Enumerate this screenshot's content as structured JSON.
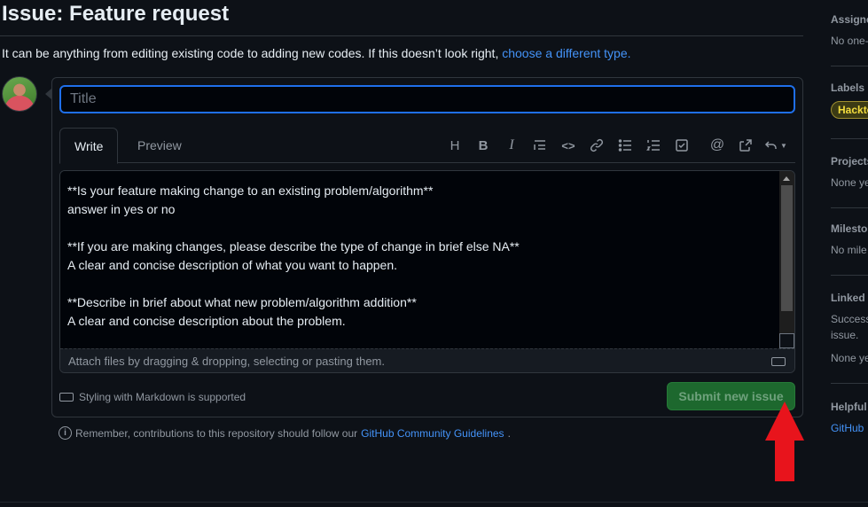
{
  "page": {
    "title": "Issue: Feature request",
    "subtitle_text": "It can be anything from editing existing code to adding new codes. If this doesn’t look right, ",
    "subtitle_link": "choose a different type."
  },
  "form": {
    "title_placeholder": "Title",
    "tabs": {
      "write": "Write",
      "preview": "Preview"
    },
    "toolbar": [
      {
        "name": "heading-icon",
        "glyph": "H"
      },
      {
        "name": "bold-icon",
        "glyph": "B"
      },
      {
        "name": "italic-icon",
        "glyph": "I"
      },
      {
        "name": "quote-icon",
        "glyph": ""
      },
      {
        "name": "code-icon",
        "glyph": "<>"
      },
      {
        "name": "link-icon",
        "glyph": ""
      },
      {
        "name": "unordered-list-icon",
        "glyph": ""
      },
      {
        "name": "ordered-list-icon",
        "glyph": ""
      },
      {
        "name": "task-list-icon",
        "glyph": ""
      },
      {
        "name": "mention-icon",
        "glyph": "@"
      },
      {
        "name": "cross-reference-icon",
        "glyph": ""
      },
      {
        "name": "undo-menu-icon",
        "glyph": ""
      }
    ],
    "body_text": "**Is your feature making change to an existing problem/algorithm**\nanswer in yes or no\n\n**If you are making changes, please describe the type of change in brief else NA**\nA clear and concise description of what you want to happen.\n\n**Describe in brief about what new problem/algorithm addition**\nA clear and concise description about the problem.",
    "attach_hint": "Attach files by dragging & dropping, selecting or pasting them.",
    "markdown_hint": "Styling with Markdown is supported",
    "submit_label": "Submit new issue"
  },
  "note": {
    "text": "Remember, contributions to this repository should follow our ",
    "link": "GitHub Community Guidelines",
    "suffix": "."
  },
  "sidebar": {
    "assignees": {
      "heading": "Assigne",
      "value": "No one-"
    },
    "labels": {
      "heading": "Labels",
      "label": "Hackto"
    },
    "projects": {
      "heading": "Projects",
      "value": "None ye"
    },
    "milestone": {
      "heading": "Milesto",
      "value": "No mile"
    },
    "linked": {
      "heading": "Linked p",
      "value1": "Success",
      "value2": "issue.",
      "value3": "None ye"
    },
    "helpful": {
      "heading": "Helpful",
      "link": "GitHub"
    }
  },
  "colors": {
    "background": "#0d1117",
    "accent_link": "#4493f8",
    "submit_green": "#238636",
    "focus_blue": "#1f6feb",
    "annotation_arrow": "#e8141c",
    "label_yellow": "#f2dc3e"
  }
}
